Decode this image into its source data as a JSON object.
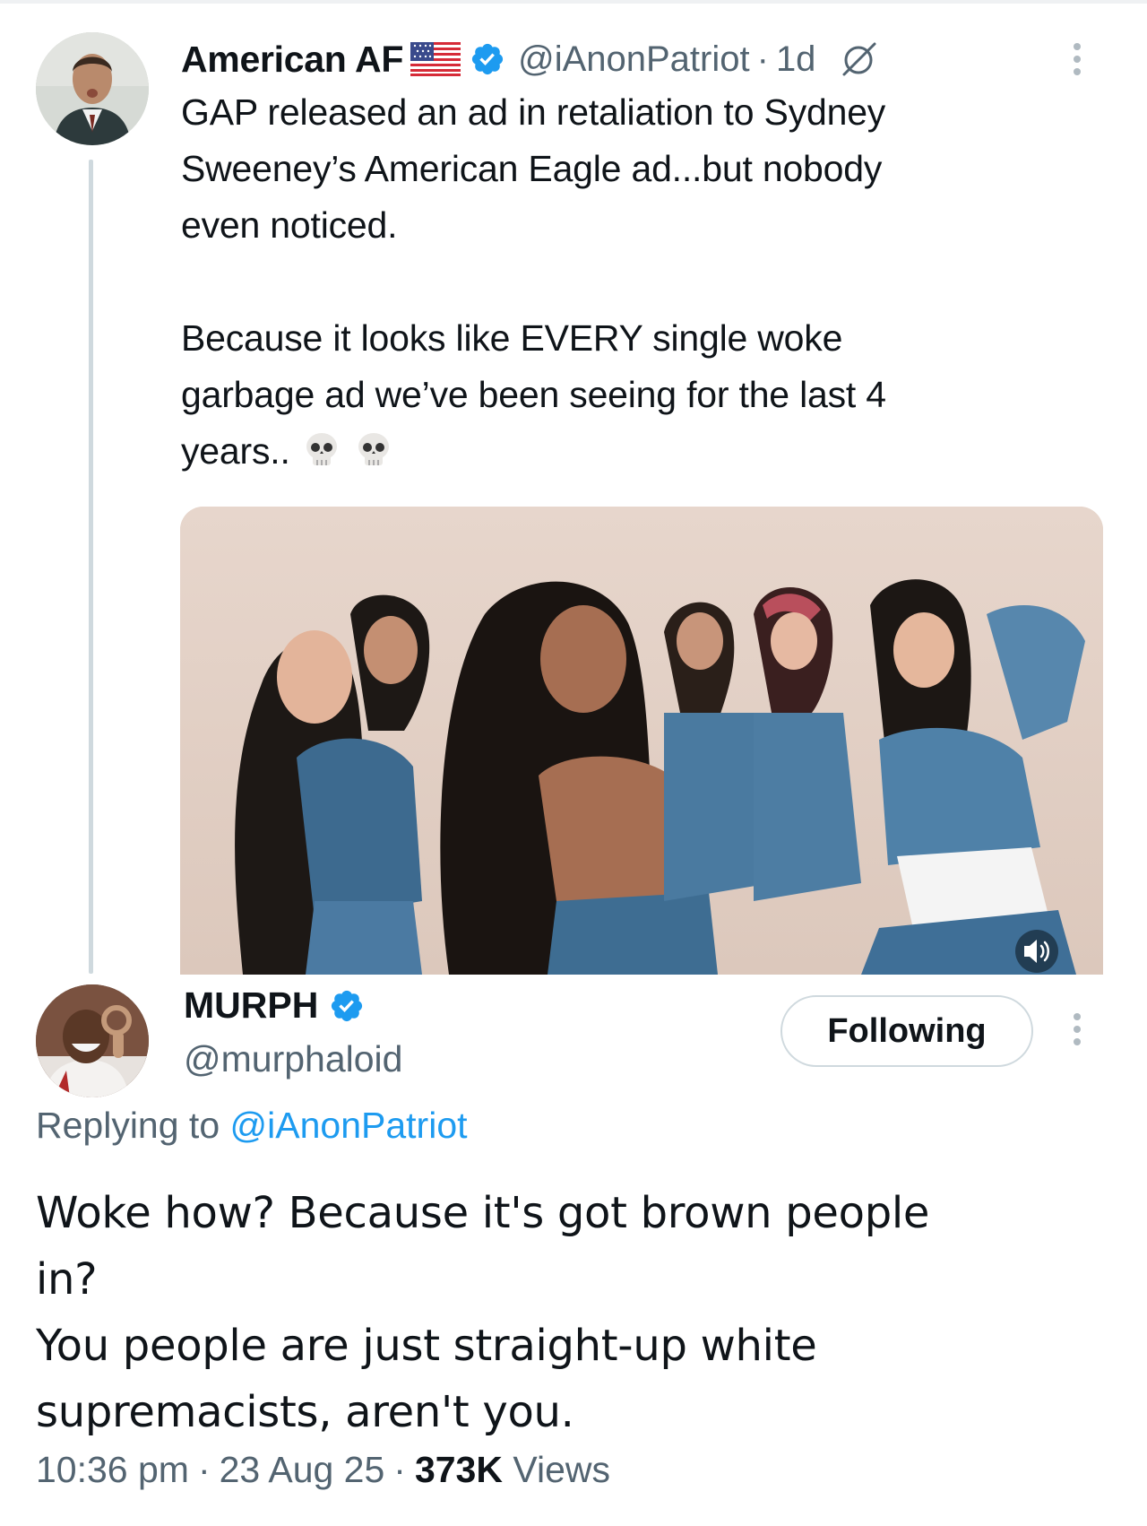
{
  "parent_tweet": {
    "display_name": "American AF",
    "handle": "@iAnonPatriot",
    "time": "1d",
    "text_lines": [
      "GAP released an ad in retaliation to Sydney",
      "Sweeney’s American Eagle ad...but nobody",
      "even noticed."
    ],
    "text_lines_2": [
      "Because it looks like EVERY single woke",
      "garbage ad we’ve been seeing for the last 4",
      "years.."
    ],
    "emoji": [
      "skull-emoji",
      "skull-emoji"
    ],
    "media": {
      "kind": "video",
      "has_sound_toggle": true
    }
  },
  "reply_tweet": {
    "display_name": "MURPH",
    "handle": "@murphaloid",
    "follow_button_label": "Following",
    "replying_prefix": "Replying to",
    "replying_to": "@iAnonPatriot",
    "text_lines": [
      "Woke how? Because it's got brown people",
      "in?",
      "You people are just straight-up white",
      "supremacists, aren't you."
    ],
    "time": "10:36 pm",
    "date": "23 Aug 25",
    "views_count": "373K",
    "views_label": "Views"
  },
  "icons": {
    "verified": "verified-badge-icon",
    "flag": "us-flag-icon",
    "grok": "grok-icon",
    "more": "more-vertical-icon",
    "volume": "volume-icon"
  },
  "colors": {
    "verified": "#1d9bf0",
    "secondary_text": "#536471",
    "mention": "#1d9bf0",
    "border": "#cfd9de"
  }
}
